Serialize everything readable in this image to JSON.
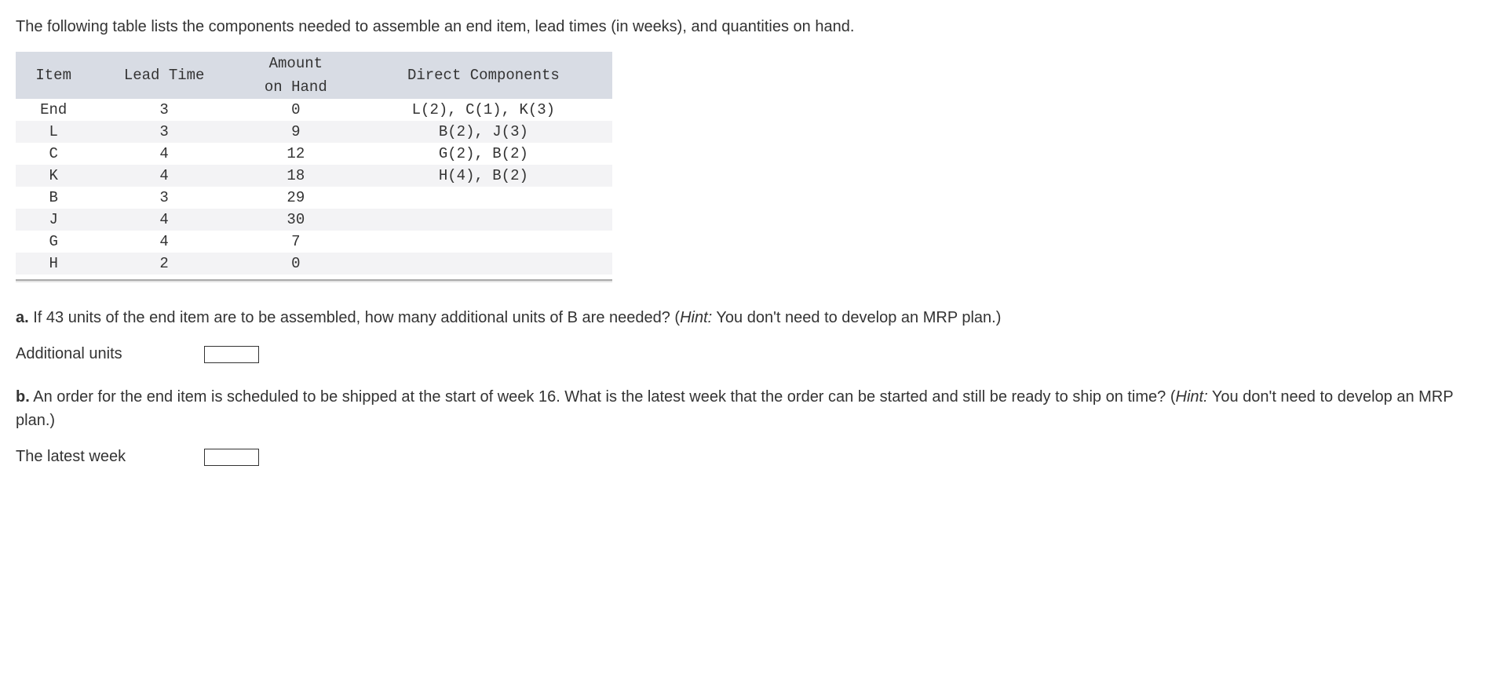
{
  "intro": "The following table lists the components needed to assemble an end item, lead times (in weeks), and quantities on hand.",
  "table": {
    "headers": {
      "item": "Item",
      "lead": "Lead Time",
      "amount_l1": "Amount",
      "amount_l2": "on Hand",
      "direct": "Direct Components"
    },
    "rows": [
      {
        "item": "End",
        "lead": "3",
        "amount": "0",
        "direct": "L(2), C(1), K(3)"
      },
      {
        "item": "L",
        "lead": "3",
        "amount": "9",
        "direct": "B(2), J(3)"
      },
      {
        "item": "C",
        "lead": "4",
        "amount": "12",
        "direct": "G(2), B(2)"
      },
      {
        "item": "K",
        "lead": "4",
        "amount": "18",
        "direct": "H(4), B(2)"
      },
      {
        "item": "B",
        "lead": "3",
        "amount": "29",
        "direct": ""
      },
      {
        "item": "J",
        "lead": "4",
        "amount": "30",
        "direct": ""
      },
      {
        "item": "G",
        "lead": "4",
        "amount": "7",
        "direct": ""
      },
      {
        "item": "H",
        "lead": "2",
        "amount": "0",
        "direct": ""
      }
    ]
  },
  "qa": {
    "label": "a.",
    "text_before_hint": " If 43 units of the end item are to be assembled, how many additional units of B are needed? (",
    "hint_label": "Hint:",
    "hint_text": " You don't need to develop an MRP plan.)",
    "answer_label": "Additional units",
    "answer_value": ""
  },
  "qb": {
    "label": "b.",
    "text_before_hint": " An order for the end item is scheduled to be shipped at the start of week 16. What is the latest week that the order can be started and still be ready to ship on time? (",
    "hint_label": "Hint:",
    "hint_text": " You don't need to develop an MRP plan.)",
    "answer_label": "The latest week",
    "answer_value": ""
  }
}
